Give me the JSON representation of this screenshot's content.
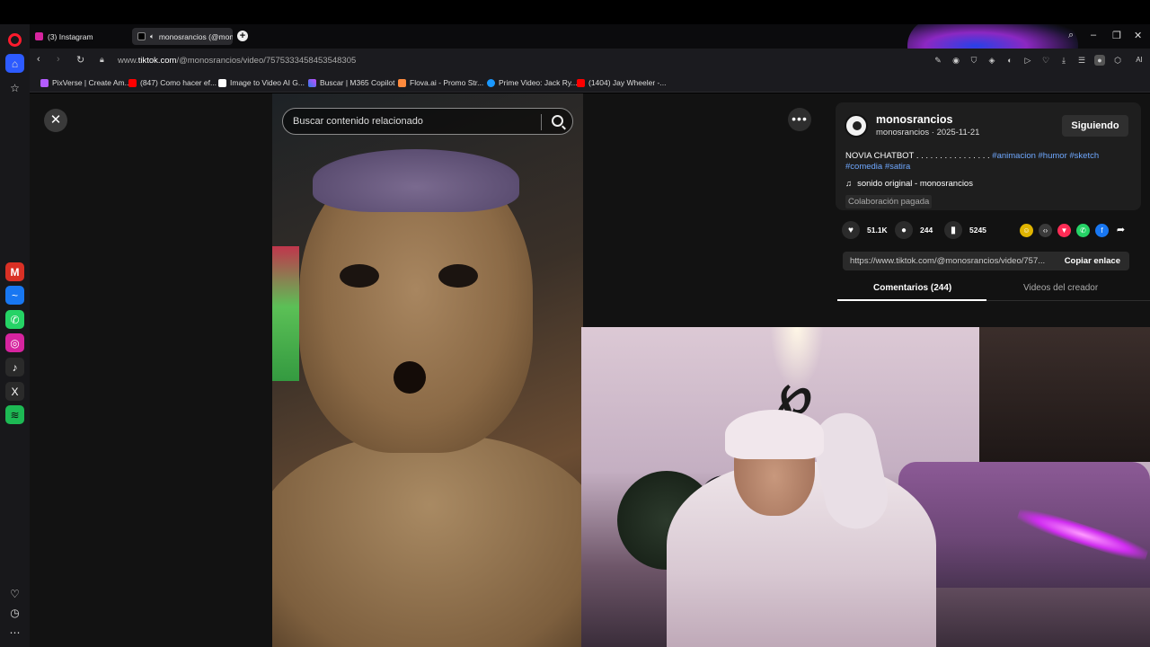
{
  "browser": {
    "tabs": [
      {
        "label": "(3) Instagram",
        "active": false
      },
      {
        "label": "monosrancios (@mon",
        "active": true
      }
    ],
    "url_prefix": "www.",
    "url_domain": "tiktok.com",
    "url_path": "/@monosrancios/video/7575333458453548305",
    "bookmarks": [
      "PixVerse | Create Am...",
      "(847) Como hacer ef...",
      "Image to Video AI G...",
      "Buscar | M365 Copilot",
      "Flova.ai - Promo Str...",
      "Prime Video: Jack Ry...",
      "(1404) Jay Wheeler -..."
    ],
    "ai_label": "AI"
  },
  "video": {
    "search_placeholder": "Buscar contenido relacionado"
  },
  "creator": {
    "username": "monosrancios",
    "meta": "monosrancios · 2025-11-21",
    "follow_label": "Siguiendo",
    "caption_text": "NOVIA CHATBOT . . . . . . . . . . . . . . . . ",
    "hashtags_line1": "#animacion #humor #sketch",
    "hashtags_line2": "#comedia #satira",
    "sound": "sonido original - monosrancios",
    "paid_label": "Colaboración pagada"
  },
  "stats": {
    "likes": "51.1K",
    "comments": "244",
    "saves": "5245"
  },
  "link": {
    "url": "https://www.tiktok.com/@monosrancios/video/757...",
    "copy_label": "Copiar enlace"
  },
  "panel_tabs": {
    "comments": "Comentarios (244)",
    "creator_videos": "Videos del creador"
  },
  "colors": {
    "hashtag": "#6fa8ff",
    "opera_red": "#ff1b2d"
  }
}
